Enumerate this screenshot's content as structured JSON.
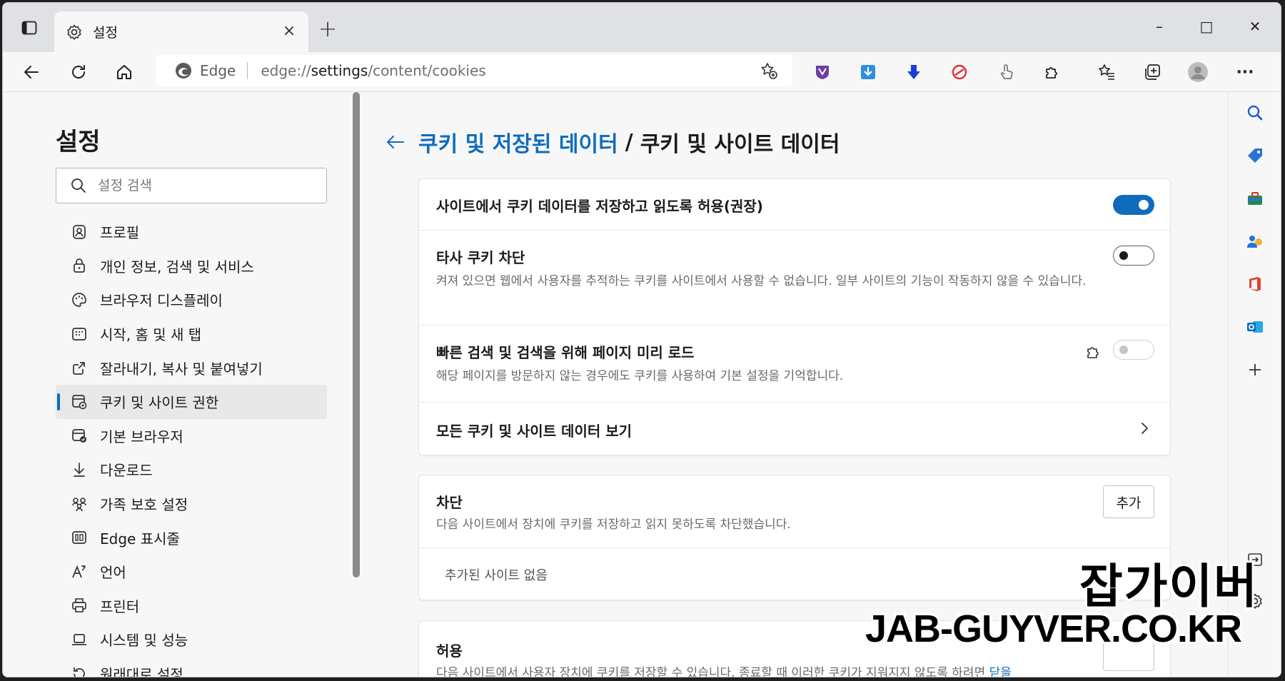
{
  "tab": {
    "title": "설정",
    "close": "×"
  },
  "newtab": "+",
  "window": {
    "minimize": "–",
    "maximize": "□",
    "close": "✕"
  },
  "address": {
    "site_label": "Edge",
    "url_prefix": "edge://",
    "url_host": "settings",
    "url_path": "/content/cookies"
  },
  "toolbar": {
    "more": "···"
  },
  "sidebar": {
    "title": "설정",
    "search_placeholder": "설정 검색",
    "items": [
      {
        "label": "프로필",
        "icon": "profile-icon"
      },
      {
        "label": "개인 정보, 검색 및 서비스",
        "icon": "lock-icon"
      },
      {
        "label": "브라우저 디스플레이",
        "icon": "palette-icon"
      },
      {
        "label": "시작, 홈 및 새 탭",
        "icon": "home-grid-icon"
      },
      {
        "label": "잘라내기, 복사 및 붙여넣기",
        "icon": "share-icon"
      },
      {
        "label": "쿠키 및 사이트 권한",
        "icon": "cookie-settings-icon",
        "active": true
      },
      {
        "label": "기본 브라우저",
        "icon": "browser-check-icon"
      },
      {
        "label": "다운로드",
        "icon": "download-icon"
      },
      {
        "label": "가족 보호 설정",
        "icon": "family-icon"
      },
      {
        "label": "Edge 표시줄",
        "icon": "edge-bar-icon"
      },
      {
        "label": "언어",
        "icon": "language-icon"
      },
      {
        "label": "프린터",
        "icon": "printer-icon"
      },
      {
        "label": "시스템 및 성능",
        "icon": "laptop-icon"
      },
      {
        "label": "원래대로 설정",
        "icon": "reset-icon"
      }
    ]
  },
  "content": {
    "breadcrumb_link": "쿠키 및 저장된 데이터",
    "breadcrumb_sep": "/",
    "breadcrumb_current": "쿠키 및 사이트 데이터",
    "settings": [
      {
        "title": "사이트에서 쿠키 데이터를 저장하고 읽도록 허용(권장)",
        "state": "on"
      },
      {
        "title": "타사 쿠키 차단",
        "desc": "켜져 있으면 웹에서 사용자를 추적하는 쿠키를 사이트에서 사용할 수 없습니다. 일부 사이트의 기능이 작동하지 않을 수 있습니다.",
        "state": "off"
      },
      {
        "title": "빠른 검색 및 검색을 위해 페이지 미리 로드",
        "desc": "해당 페이지를 방문하지 않는 경우에도 쿠키를 사용하여 기본 설정을 기억합니다.",
        "state": "disabled"
      },
      {
        "title": "모든 쿠키 및 사이트 데이터 보기"
      }
    ],
    "block": {
      "title": "차단",
      "desc": "다음 사이트에서 장치에 쿠키를 저장하고 읽지 못하도록 차단했습니다.",
      "add": "추가",
      "empty": "추가된 사이트 없음"
    },
    "allow": {
      "title": "허용",
      "desc": "다음 사이트에서 사용자 장치에 쿠키를 저장할 수 있습니다. 종료할 때 이러한 쿠키가 지워지지 않도록 하려면",
      "link": "닫을"
    }
  },
  "watermark": {
    "line1": "잡가이버",
    "line2": "JAB-GUYVER.CO.KR"
  },
  "colors": {
    "accent": "#0f6cbd",
    "background": "#f7f7f7",
    "card": "#ffffff"
  }
}
